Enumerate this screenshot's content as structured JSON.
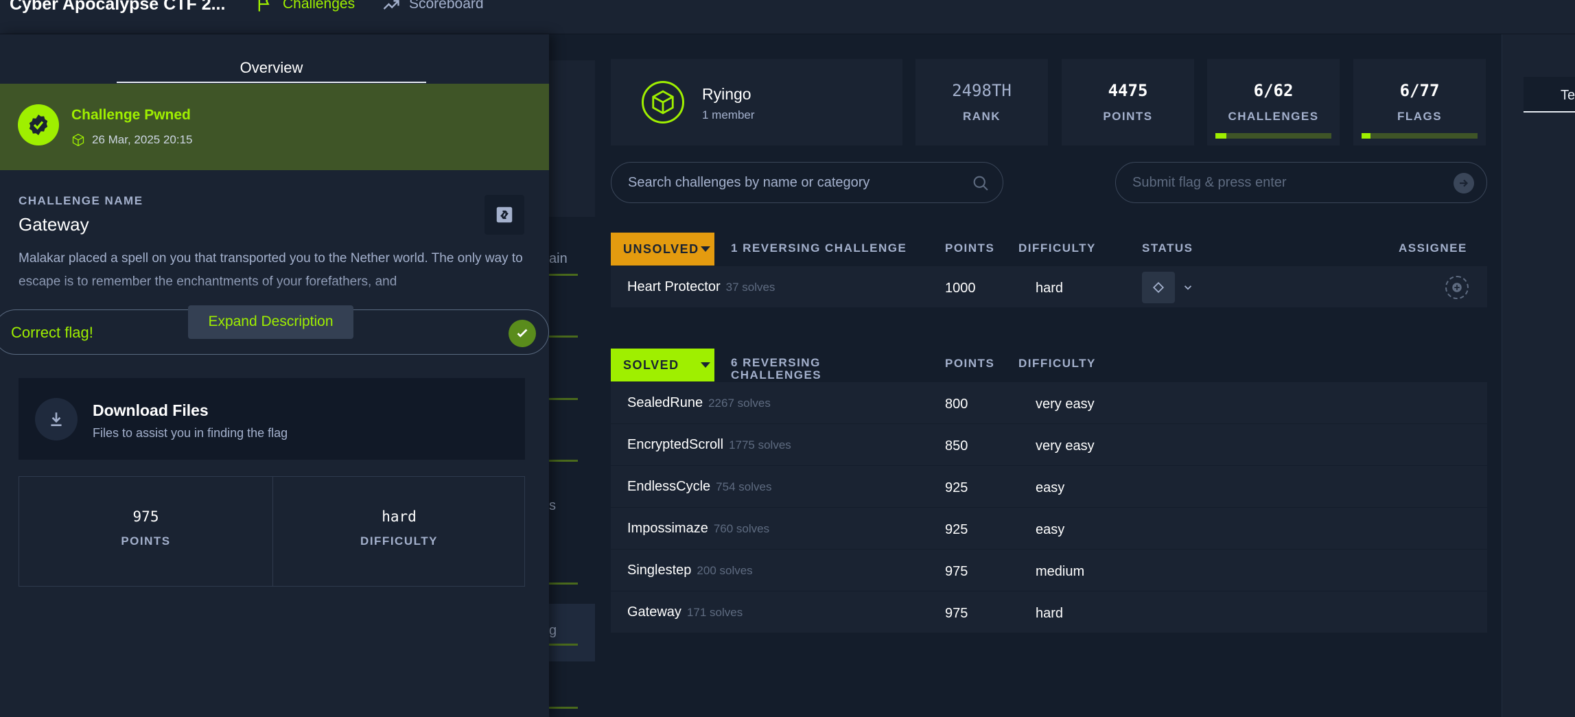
{
  "topbar": {
    "app_title": "Cyber Apocalypse CTF 2...",
    "nav": [
      {
        "label": "Challenges",
        "icon": "flag-icon",
        "active": true
      },
      {
        "label": "Scoreboard",
        "icon": "trend-chart-icon",
        "active": false
      }
    ]
  },
  "sidebar": {
    "tab": "Overview",
    "pwned": {
      "title": "Challenge Pwned",
      "date": "26 Mar, 2025 20:15"
    },
    "challenge_name_label": "CHALLENGE NAME",
    "challenge_name": "Gateway",
    "description": "Malakar placed a spell on you that transported you to the Nether world. The only way to escape is to remember the enchantments of your forefathers, and",
    "flag_status": "Correct flag!",
    "expand_label": "Expand Description",
    "download": {
      "title": "Download Files",
      "subtitle": "Files to assist you in finding the flag"
    },
    "stats": {
      "points": "975",
      "points_label": "POINTS",
      "difficulty": "hard",
      "difficulty_label": "DIFFICULTY"
    }
  },
  "behind": {
    "fragment_1": "ain",
    "fragment_2": "s",
    "fragment_3": "g"
  },
  "right_tab": "Te",
  "team": {
    "name": "Ryingo",
    "members": "1 member",
    "rank": "2498TH",
    "rank_label": "RANK",
    "points": "4475",
    "points_label": "POINTS",
    "challenges": "6/62",
    "challenges_label": "CHALLENGES",
    "challenges_progress": 0.097,
    "flags": "6/77",
    "flags_label": "FLAGS",
    "flags_progress": 0.078
  },
  "search": {
    "placeholder": "Search challenges by name or category"
  },
  "submit_flag": {
    "placeholder": "Submit flag & press enter"
  },
  "columns": {
    "points": "POINTS",
    "difficulty": "DIFFICULTY",
    "status": "STATUS",
    "assignee": "ASSIGNEE"
  },
  "unsolved": {
    "badge": "UNSOLVED",
    "heading": "1 REVERSING CHALLENGE",
    "rows": [
      {
        "name": "Heart Protector",
        "solves": "37 solves",
        "points": "1000",
        "difficulty": "hard"
      }
    ]
  },
  "solved": {
    "badge": "SOLVED",
    "heading_line1": "6 REVERSING",
    "heading_line2": "CHALLENGES",
    "rows": [
      {
        "name": "SealedRune",
        "solves": "2267 solves",
        "points": "800",
        "difficulty": "very easy"
      },
      {
        "name": "EncryptedScroll",
        "solves": "1775 solves",
        "points": "850",
        "difficulty": "very easy"
      },
      {
        "name": "EndlessCycle",
        "solves": "754 solves",
        "points": "925",
        "difficulty": "easy"
      },
      {
        "name": "Impossimaze",
        "solves": "760 solves",
        "points": "925",
        "difficulty": "easy"
      },
      {
        "name": "Singlestep",
        "solves": "200 solves",
        "points": "975",
        "difficulty": "medium"
      },
      {
        "name": "Gateway",
        "solves": "171 solves",
        "points": "975",
        "difficulty": "hard"
      }
    ]
  },
  "colors": {
    "accent": "#9fef00",
    "unsolved": "#e49b0f",
    "bg": "#141d2b",
    "panel": "#1a2332"
  }
}
